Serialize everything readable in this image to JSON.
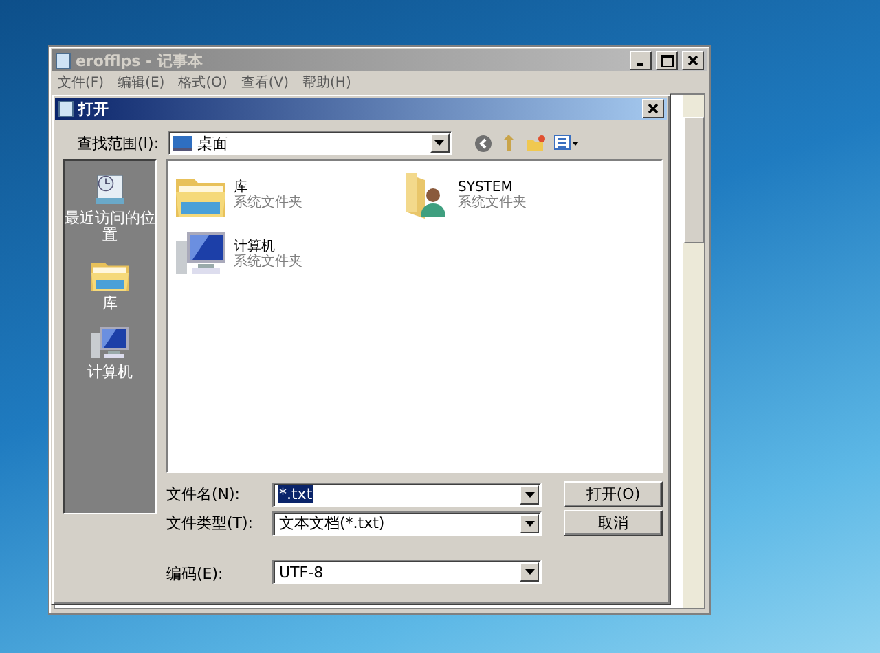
{
  "notepad": {
    "title": "erofflps - 记事本",
    "menu": [
      "文件(F)",
      "编辑(E)",
      "格式(O)",
      "查看(V)",
      "帮助(H)"
    ]
  },
  "dialog": {
    "title": "打开",
    "look_in": {
      "label": "查找范围(I):",
      "value": "桌面"
    },
    "places": [
      {
        "kind": "recent",
        "label": "最近访问的位置"
      },
      {
        "kind": "library",
        "label": "库"
      },
      {
        "kind": "computer",
        "label": "计算机"
      }
    ],
    "files": [
      {
        "kind": "library",
        "name": "库",
        "type": "系统文件夹"
      },
      {
        "kind": "user",
        "name": "SYSTEM",
        "type": "系统文件夹"
      },
      {
        "kind": "computer",
        "name": "计算机",
        "type": "系统文件夹"
      }
    ],
    "fields": [
      {
        "label": "文件名(N):",
        "value": "*.txt",
        "selected": true
      },
      {
        "label": "文件类型(T):",
        "value": "文本文档(*.txt)",
        "selected": false
      },
      {
        "label": "编码(E):",
        "value": "UTF-8",
        "selected": false
      }
    ],
    "buttons": [
      "打开(O)",
      "取消"
    ]
  }
}
